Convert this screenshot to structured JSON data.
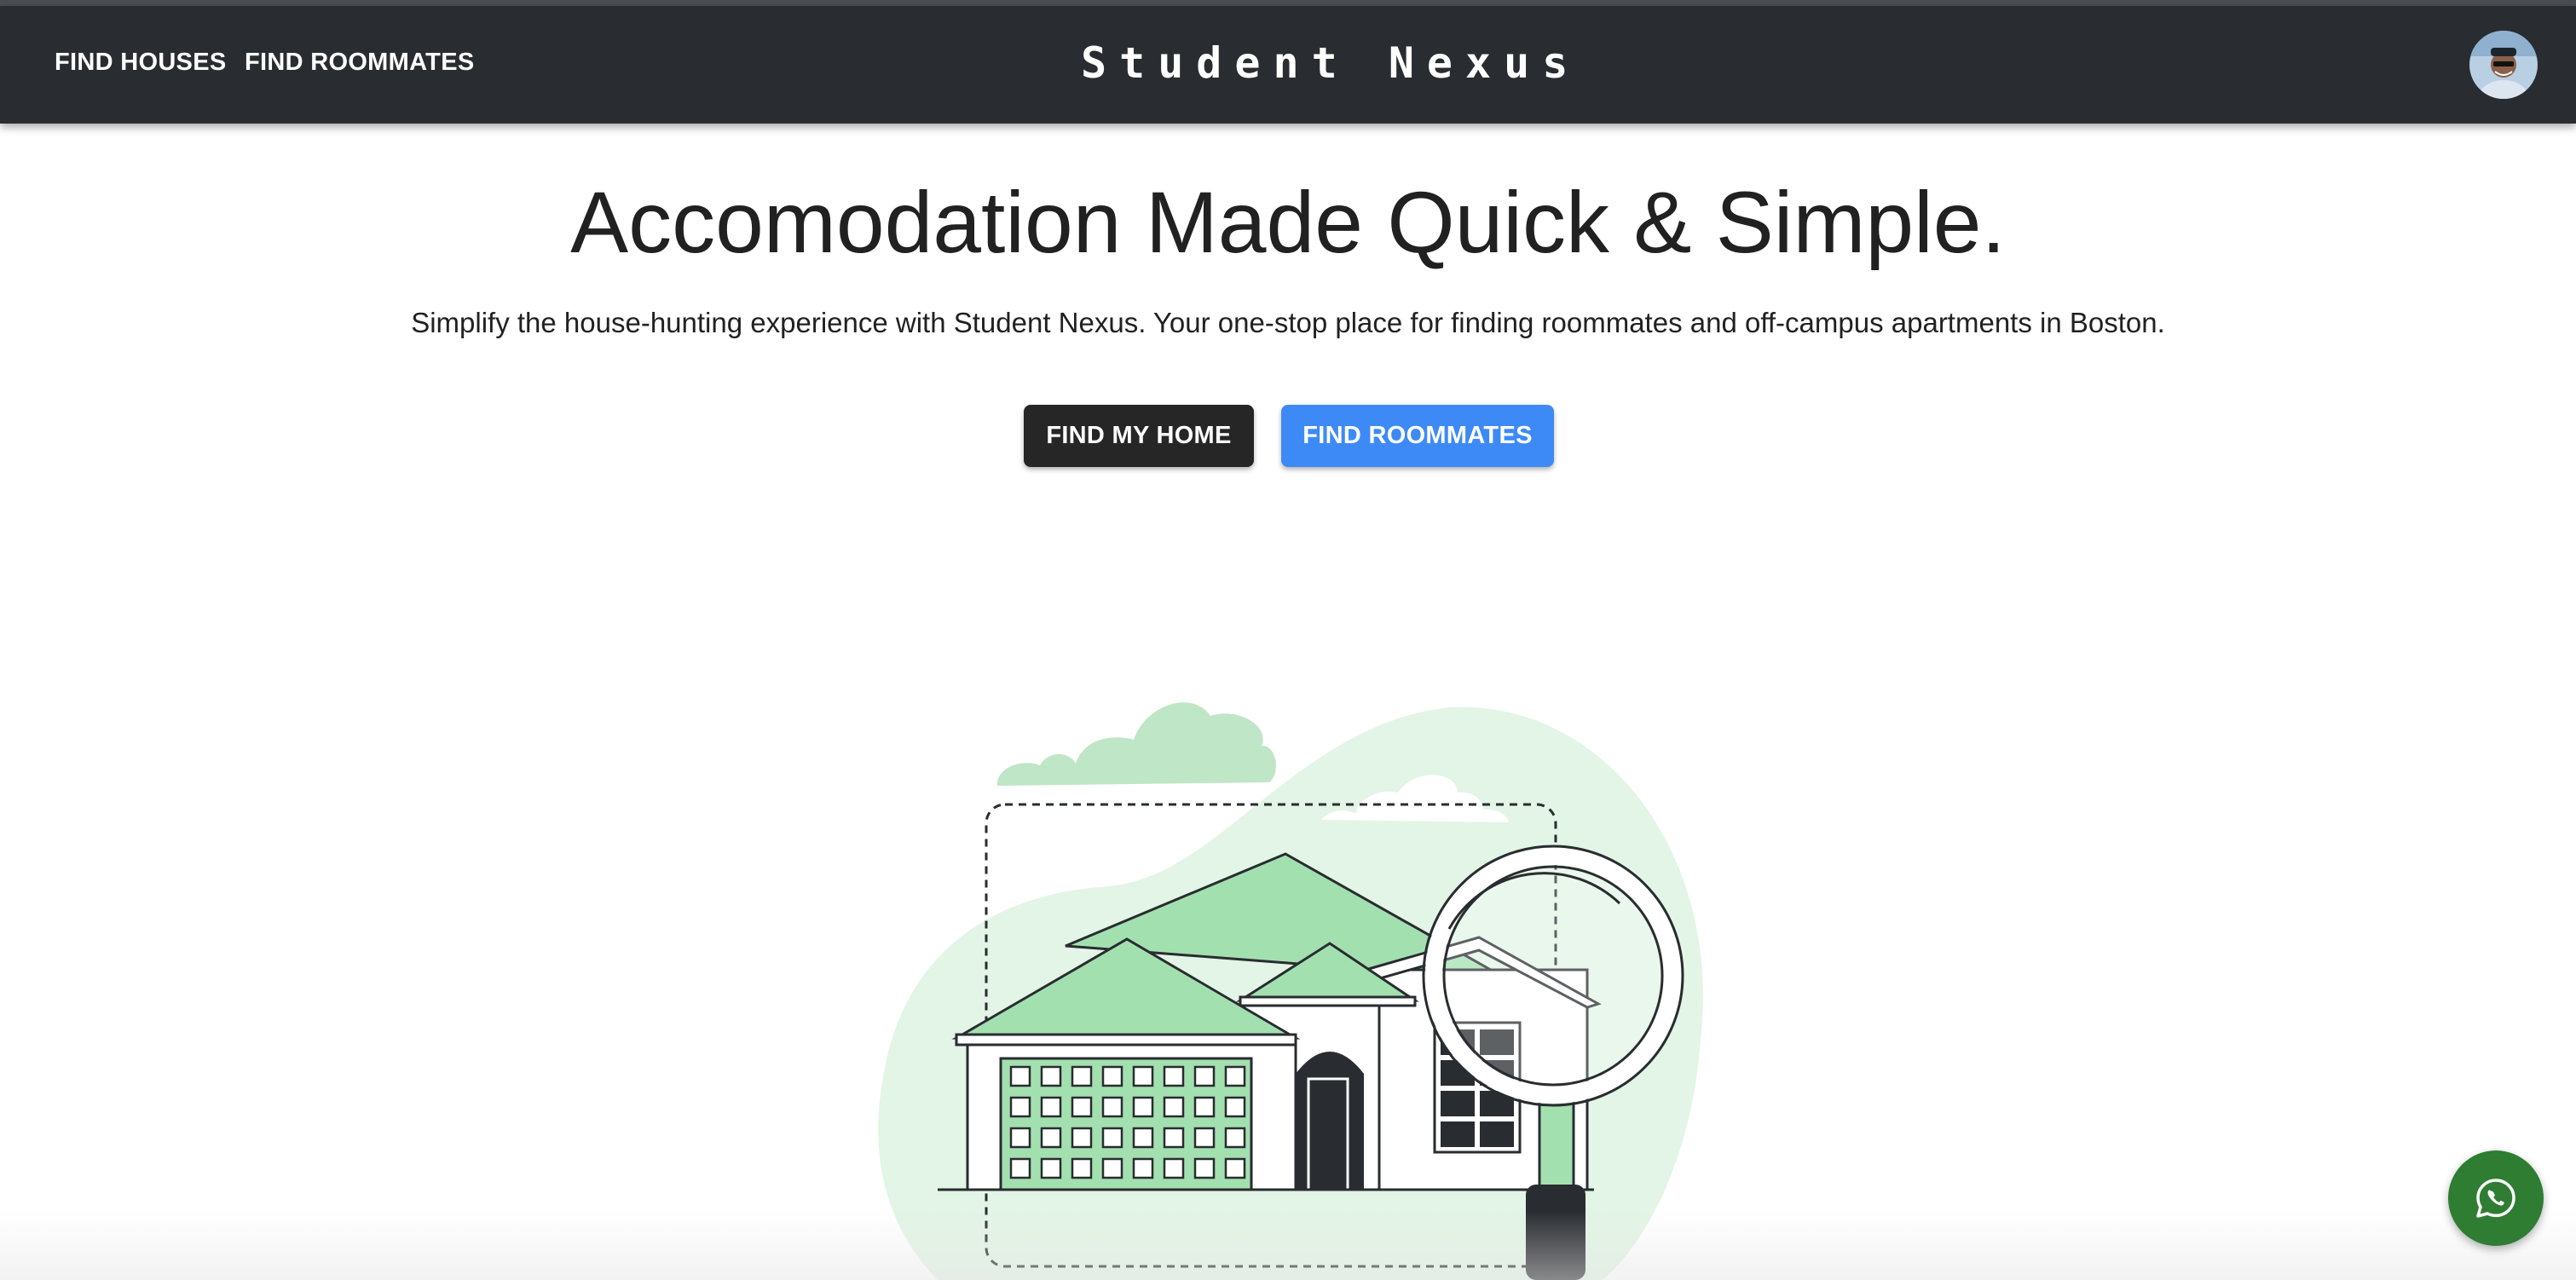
{
  "nav": {
    "links": [
      "FIND HOUSES",
      "FIND ROOMMATES"
    ],
    "brand": "Student Nexus",
    "avatar_icon": "user-avatar"
  },
  "hero": {
    "title": "Accomodation Made Quick & Simple.",
    "subtitle": "Simplify the house-hunting experience with Student Nexus. Your one-stop place for finding roommates and off-campus apartments in Boston.",
    "buttons": {
      "primary": "FIND MY HOME",
      "secondary": "FIND ROOMMATES"
    }
  },
  "illustration": {
    "icon": "house-search-illustration",
    "accent_color": "#a3e0b0",
    "light_color": "#e3f5e6",
    "dark_color": "#292c30"
  },
  "fab": {
    "icon": "whatsapp-icon",
    "color": "#2e7d32"
  },
  "colors": {
    "navbar": "#292c30",
    "primary_button": "#262626",
    "secondary_button": "#3d8af7"
  }
}
